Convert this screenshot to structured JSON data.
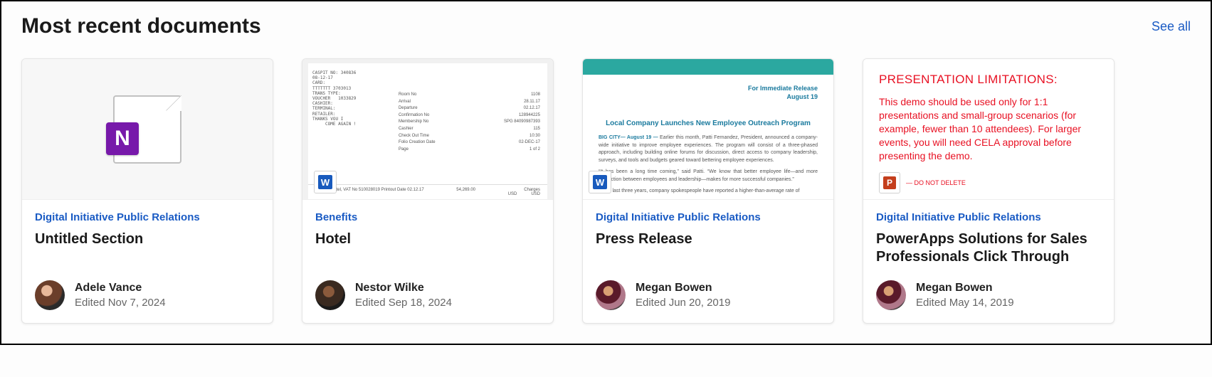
{
  "header": {
    "title": "Most recent documents",
    "see_all": "See all"
  },
  "cards": [
    {
      "category": "Digital Initiative Public Relations",
      "title": "Untitled Section",
      "author": "Adele Vance",
      "edited": "Edited Nov 7, 2024",
      "thumb_icon": "onenote-icon"
    },
    {
      "category": "Benefits",
      "title": "Hotel",
      "author": "Nestor Wilke",
      "edited": "Edited Sep 18, 2024",
      "thumb": {
        "receipt_left": "CASPIT NO: 340836\n08-12-17\nCARD:\nTTTTTTT 3703013\nTRANS TYPE:\nVOUCHER   1033829\nCASHIER:\nTERMINAL:\nRETAILER:\nTHANKS VOU I\n     COME AGAIN !",
        "receipt_rows": [
          {
            "k": "Room No",
            "v": "1108"
          },
          {
            "k": "Arrival",
            "v": "28.11.17"
          },
          {
            "k": "Departure",
            "v": "02.12.17"
          },
          {
            "k": "Confirmation No",
            "v": "128944225"
          },
          {
            "k": "Membership No",
            "v": "SPG   84090987393"
          },
          {
            "k": "Cashier",
            "v": "115"
          },
          {
            "k": "Check Out Time",
            "v": "10:30"
          },
          {
            "k": "Folio Creation Date",
            "v": "02-DEC-17"
          },
          {
            "k": "Page",
            "v": "1 of 2"
          }
        ],
        "receipt_bottom_left": "Tel Aviv Hotel,   VAT No  510028019   Printout Date       02.12.17",
        "receipt_bottom_mid": "54,269.00",
        "receipt_bottom_right": "Charges\nUSD            USD"
      }
    },
    {
      "category": "Digital Initiative Public Relations",
      "title": "Press Release",
      "author": "Megan Bowen",
      "edited": "Edited Jun 20, 2019",
      "thumb": {
        "tag_line1": "For Immediate Release",
        "tag_line2": "August 19",
        "headline": "Local Company Launches New Employee Outreach Program",
        "lead": "BIG CITY— August 19 —",
        "para1": "Earlier this month, Patti Fernandez, President, announced a company-wide initiative to improve employee experiences. The program will consist of a three-phased approach, including building online forums for discussion, direct access to company leadership, surveys, and tools and budgets geared toward bettering employee experiences.",
        "para2": "“It has been a long time coming,” said Patti. “We know that better employee life—and more interaction between employees and leadership—makes for more successful companies.”",
        "para3": "In the last three years, company spokespeople have reported a higher-than-average rate of"
      }
    },
    {
      "category": "Digital Initiative Public Relations",
      "title": "PowerApps Solutions for Sales Professionals Click Through",
      "author": "Megan Bowen",
      "edited": "Edited May 14, 2019",
      "thumb": {
        "heading": "PRESENTATION LIMITATIONS:",
        "body": "This demo should be used only for 1:1 presentations and small-group scenarios (for example, fewer than 10 attendees). For larger events, you will need CELA approval before presenting the demo.",
        "chip_text": "— DO NOT DELETE"
      }
    }
  ]
}
